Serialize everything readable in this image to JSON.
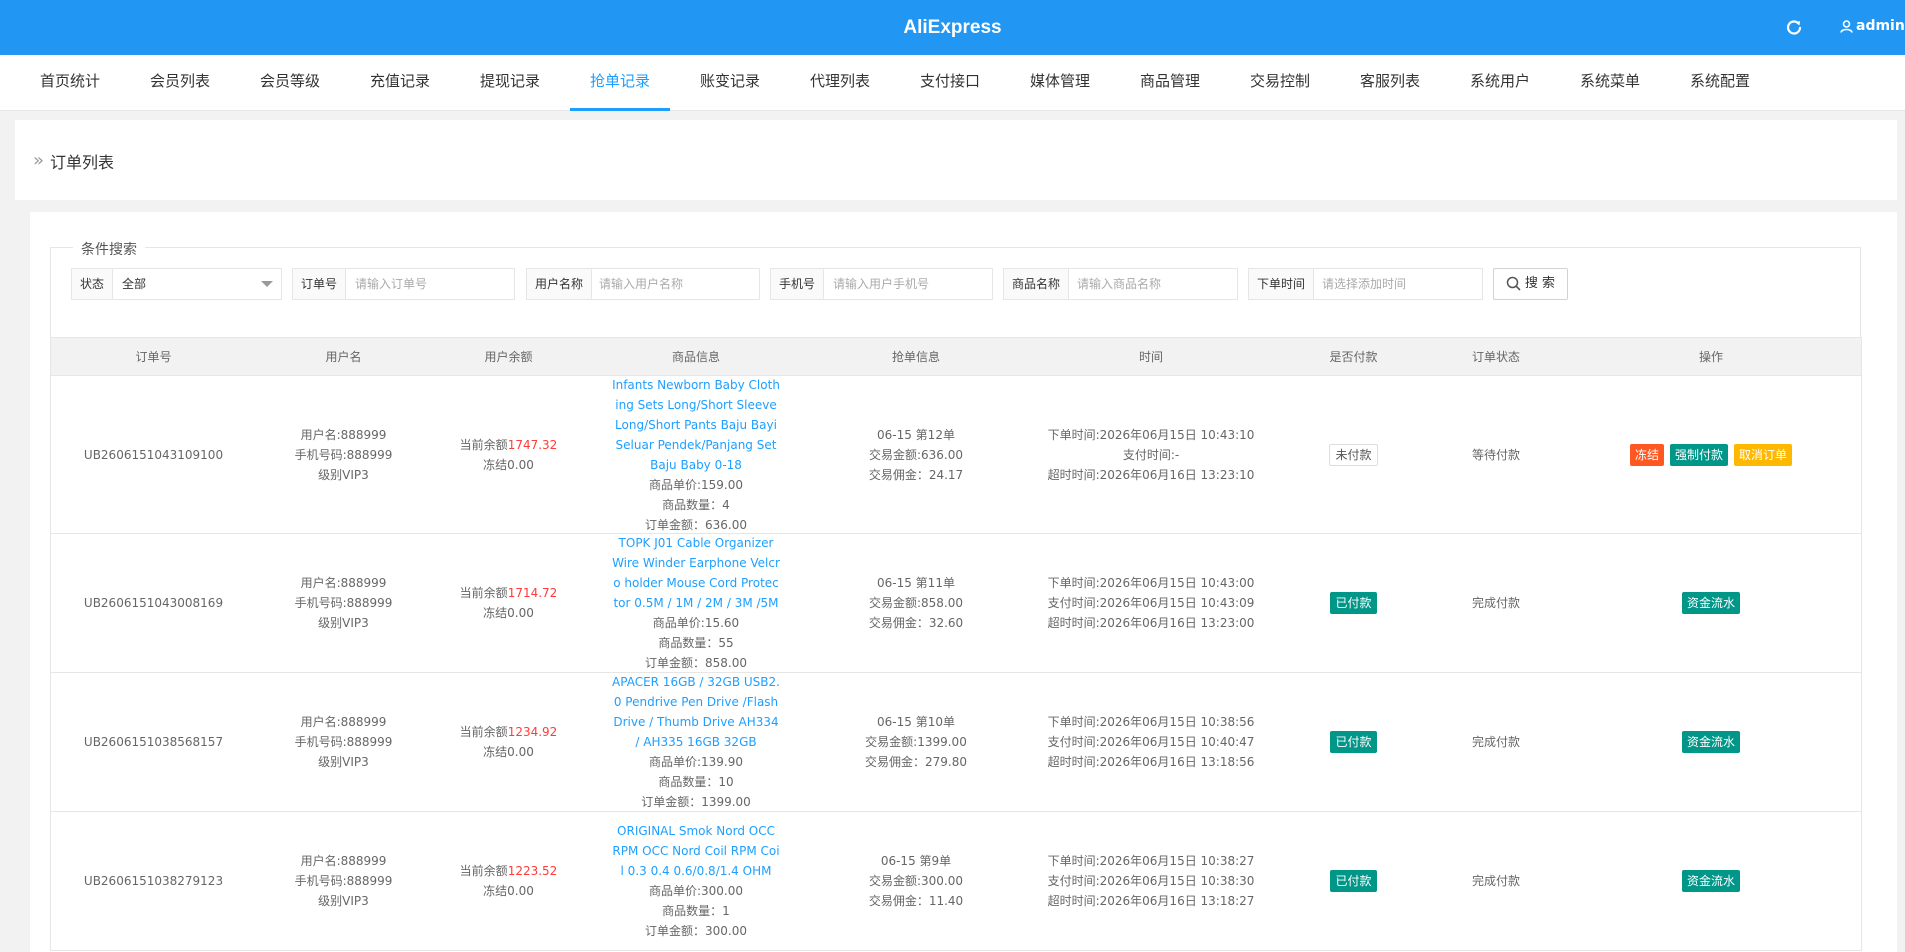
{
  "header": {
    "brand": "AliExpress",
    "user": "admin"
  },
  "nav": {
    "tabs": [
      "首页统计",
      "会员列表",
      "会员等级",
      "充值记录",
      "提现记录",
      "抢单记录",
      "账变记录",
      "代理列表",
      "支付接口",
      "媒体管理",
      "商品管理",
      "交易控制",
      "客服列表",
      "系统用户",
      "系统菜单",
      "系统配置"
    ],
    "active": "抢单记录"
  },
  "breadcrumb": {
    "arrow": "»",
    "title": "订单列表"
  },
  "search": {
    "legend": "条件搜索",
    "status_label": "状态",
    "status_value": "全部",
    "order_label": "订单号",
    "order_placeholder": "请输入订单号",
    "username_label": "用户名称",
    "username_placeholder": "请输入用户名称",
    "phone_label": "手机号",
    "phone_placeholder": "请输入用户手机号",
    "goods_label": "商品名称",
    "goods_placeholder": "请输入商品名称",
    "time_label": "下单时间",
    "time_placeholder": "请选择添加时间",
    "button": "搜 索"
  },
  "table": {
    "headers": [
      "订单号",
      "用户名",
      "用户余额",
      "商品信息",
      "抢单信息",
      "时间",
      "是否付款",
      "订单状态",
      "操作"
    ],
    "rows": [
      {
        "order_no": "UB2606151043109100",
        "user": [
          "用户名:888999",
          "手机号码:888999",
          "级别VIP3"
        ],
        "balance_prefix": "当前余额",
        "balance": "1747.32",
        "frozen": "冻结0.00",
        "goods_name": "Infants Newborn Baby Clothing Sets Long/Short Sleeve Long/Short Pants Baju Bayi Seluar Pendek/Panjang Set Baju Baby 0-18",
        "goods_lines": [
          "商品单价:159.00",
          "商品数量：4",
          "订单金额：636.00"
        ],
        "grab": [
          "06-15 第12单",
          "交易金额:636.00",
          "交易佣金：24.17"
        ],
        "time": [
          "下单时间:2026年06月15日 10:43:10",
          "支付时间:-",
          "超时时间:2026年06月16日 13:23:10"
        ],
        "paid": "未付款",
        "paid_state": "unpaid",
        "status": "等待付款",
        "actions": [
          "冻结",
          "强制付款",
          "取消订单"
        ]
      },
      {
        "order_no": "UB2606151043008169",
        "user": [
          "用户名:888999",
          "手机号码:888999",
          "级别VIP3"
        ],
        "balance_prefix": "当前余额",
        "balance": "1714.72",
        "frozen": "冻结0.00",
        "goods_name": "TOPK J01 Cable Organizer Wire Winder Earphone Velcro holder Mouse Cord Protector 0.5M / 1M / 2M / 3M /5M",
        "goods_lines": [
          "商品单价:15.60",
          "商品数量：55",
          "订单金额：858.00"
        ],
        "grab": [
          "06-15 第11单",
          "交易金额:858.00",
          "交易佣金：32.60"
        ],
        "time": [
          "下单时间:2026年06月15日 10:43:00",
          "支付时间:2026年06月15日 10:43:09",
          "超时时间:2026年06月16日 13:23:00"
        ],
        "paid": "已付款",
        "paid_state": "paid",
        "status": "完成付款",
        "actions": [
          "资金流水"
        ]
      },
      {
        "order_no": "UB2606151038568157",
        "user": [
          "用户名:888999",
          "手机号码:888999",
          "级别VIP3"
        ],
        "balance_prefix": "当前余额",
        "balance": "1234.92",
        "frozen": "冻结0.00",
        "goods_name": "APACER 16GB / 32GB USB2.0 Pendrive Pen Drive /Flash Drive / Thumb Drive AH334 / AH335 16GB 32GB",
        "goods_lines": [
          "商品单价:139.90",
          "商品数量：10",
          "订单金额：1399.00"
        ],
        "grab": [
          "06-15 第10单",
          "交易金额:1399.00",
          "交易佣金：279.80"
        ],
        "time": [
          "下单时间:2026年06月15日 10:38:56",
          "支付时间:2026年06月15日 10:40:47",
          "超时时间:2026年06月16日 13:18:56"
        ],
        "paid": "已付款",
        "paid_state": "paid",
        "status": "完成付款",
        "actions": [
          "资金流水"
        ]
      },
      {
        "order_no": "UB2606151038279123",
        "user": [
          "用户名:888999",
          "手机号码:888999",
          "级别VIP3"
        ],
        "balance_prefix": "当前余额",
        "balance": "1223.52",
        "frozen": "冻结0.00",
        "goods_name": "ORIGINAL Smok Nord OCC RPM OCC Nord Coil RPM Coil 0.3 0.4 0.6/0.8/1.4 OHM",
        "goods_lines": [
          "商品单价:300.00",
          "商品数量：1",
          "订单金额：300.00"
        ],
        "grab": [
          "06-15 第9单",
          "交易金额:300.00",
          "交易佣金：11.40"
        ],
        "time": [
          "下单时间:2026年06月15日 10:38:27",
          "支付时间:2026年06月15日 10:38:30",
          "超时时间:2026年06月16日 13:18:27"
        ],
        "paid": "已付款",
        "paid_state": "paid",
        "status": "完成付款",
        "actions": [
          "资金流水"
        ]
      }
    ]
  }
}
